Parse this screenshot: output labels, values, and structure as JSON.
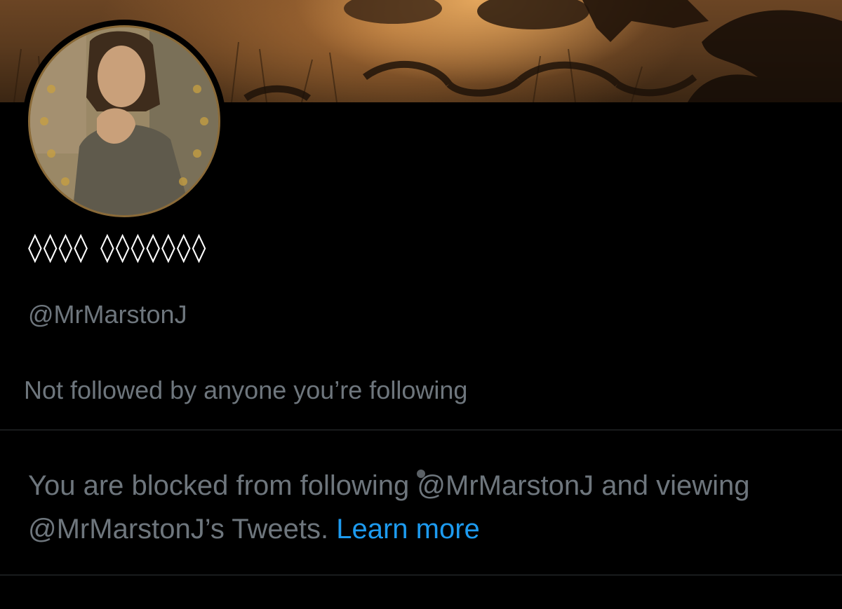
{
  "profile": {
    "display_name": "◊◊◊◊ ◊◊◊◊◊◊◊",
    "handle": "@MrMarstonJ",
    "social_context": "Not followed by anyone you’re following",
    "blocked_notice": {
      "text": "You are blocked from following @MrMarstonJ and viewing @MrMarstonJ’s Tweets. ",
      "link_label": "Learn more"
    }
  },
  "colors": {
    "background": "#000000",
    "secondary_text": "#6e767d",
    "link": "#1d9bf0",
    "divider": "#2f3336"
  },
  "icons": {
    "avatar": "profile-photo",
    "banner": "header-image"
  }
}
